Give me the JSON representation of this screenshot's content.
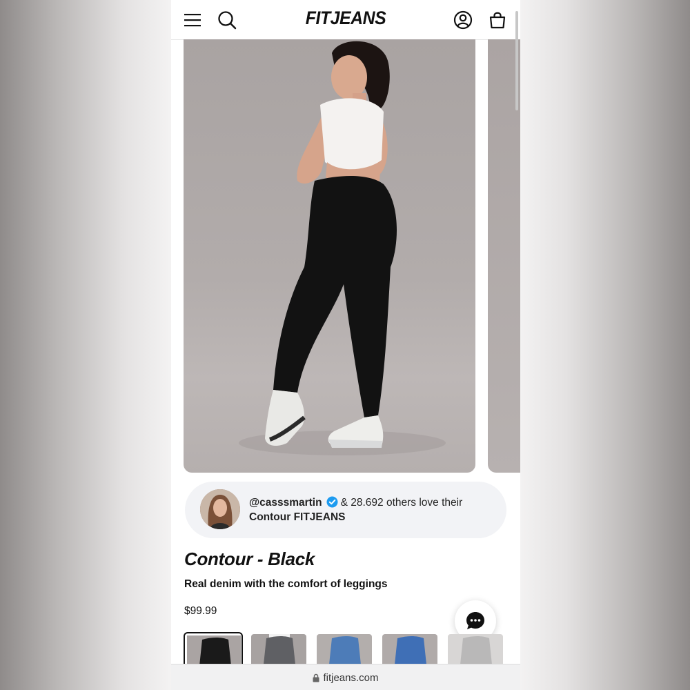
{
  "header": {
    "logo": "FITJEANS",
    "icons": [
      "menu-icon",
      "search-icon",
      "account-icon",
      "cart-icon"
    ]
  },
  "gallery": {
    "image_alt": "Model wearing black contour jeans and white cropped t-shirt"
  },
  "social_proof": {
    "handle": "@casssmartin",
    "others_text": "& 28.692 others love their",
    "product_text": "Contour FITJEANS"
  },
  "product": {
    "title": "Contour - Black",
    "subtitle": "Real denim with the comfort of leggings",
    "price": "$99.99"
  },
  "swatches": [
    {
      "name": "Black",
      "color": "#1a1a1a",
      "selected": true
    },
    {
      "name": "Grey",
      "color": "#5f6064",
      "selected": false
    },
    {
      "name": "Mid Blue",
      "color": "#4d7cb8",
      "selected": false
    },
    {
      "name": "Bright Blue",
      "color": "#3f6fb6",
      "selected": false
    },
    {
      "name": "Light Grey",
      "color": "#b9b8b8",
      "selected": false
    }
  ],
  "browser": {
    "url": "fitjeans.com"
  },
  "colors": {
    "background": "#ffffff",
    "text": "#111111",
    "social_bg": "#f2f3f6",
    "verified": "#1d9bf0",
    "photo_bg": "#b2acab"
  }
}
